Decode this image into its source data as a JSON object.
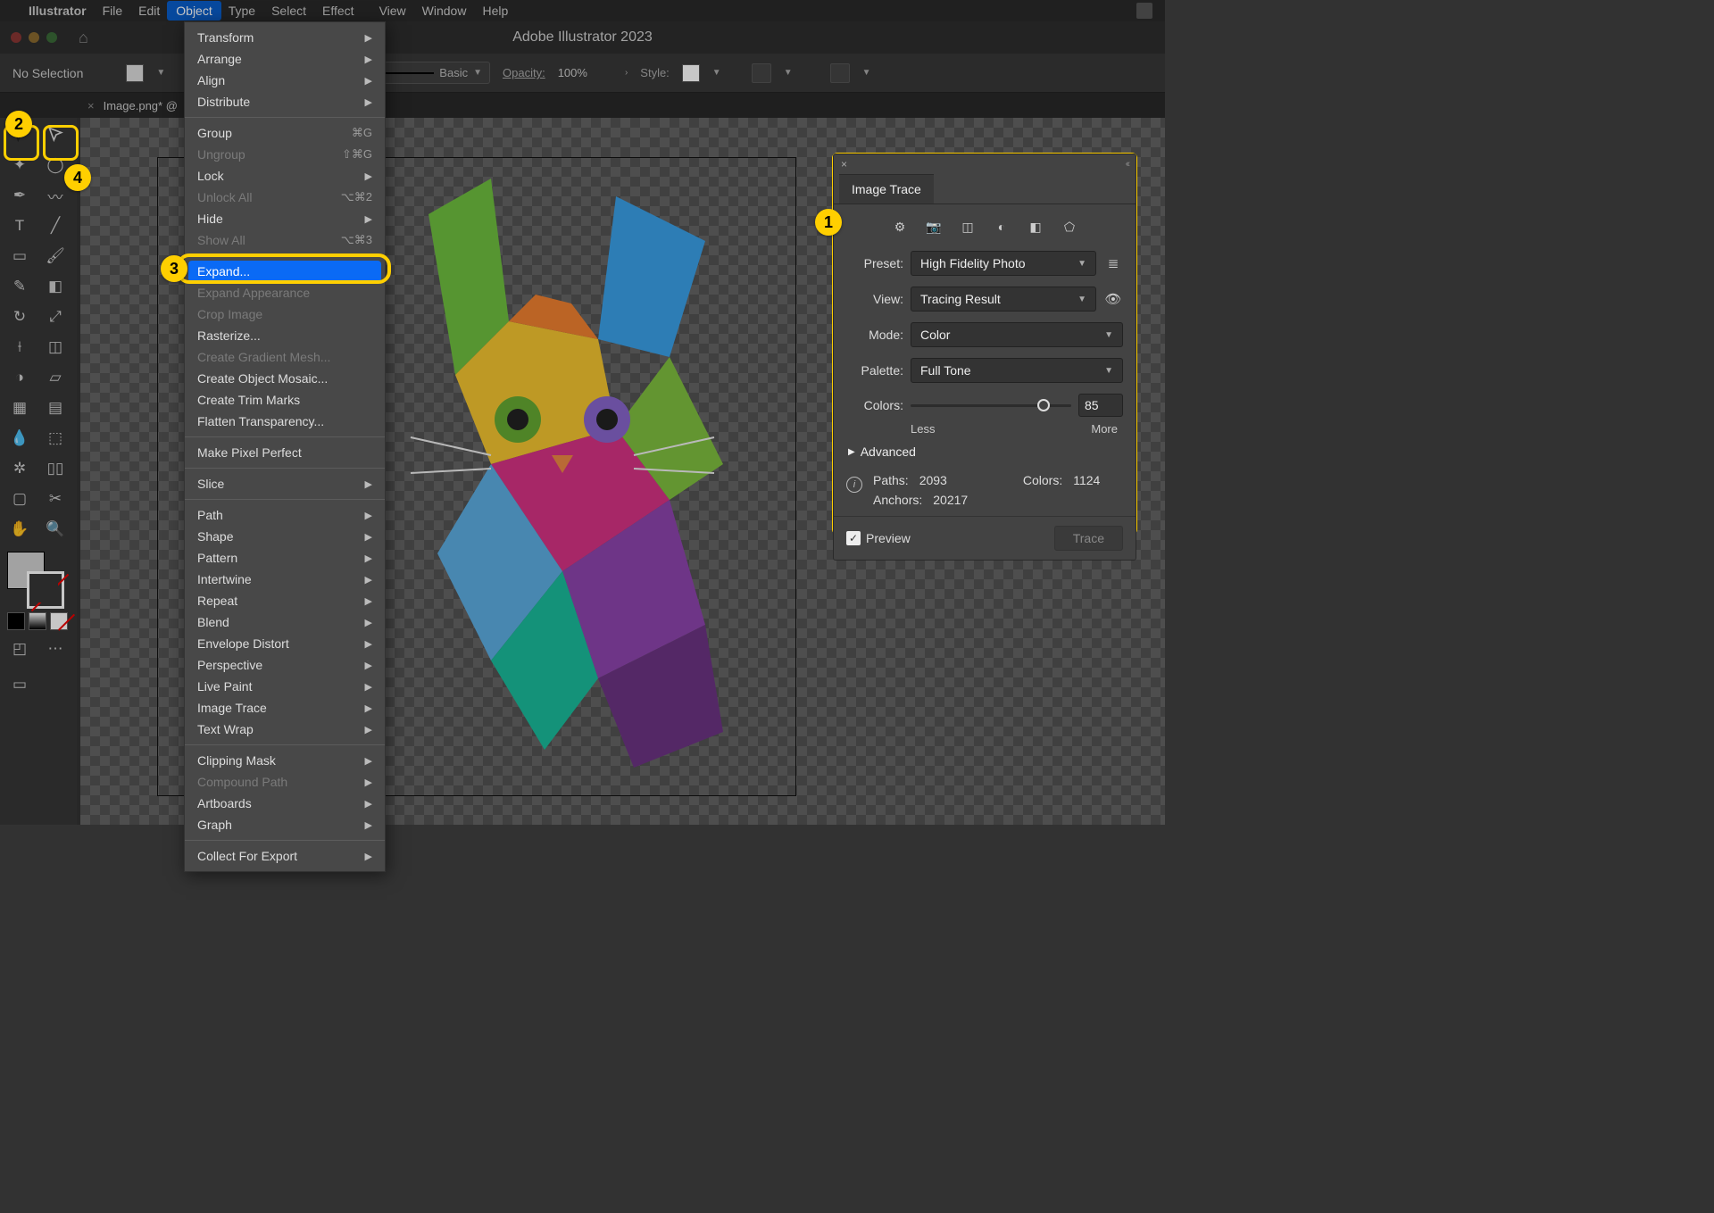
{
  "menubar": {
    "appname": "Illustrator",
    "items": [
      "File",
      "Edit",
      "Object",
      "Type",
      "Select",
      "Effect",
      "View",
      "Window",
      "Help"
    ],
    "active": "Object"
  },
  "window": {
    "title": "Adobe Illustrator 2023"
  },
  "optbar": {
    "selection": "No Selection",
    "stroke_style": "Basic",
    "opacity_label": "Opacity:",
    "opacity_value": "100%",
    "style_label": "Style:"
  },
  "doctab": {
    "name": "Image.png* @"
  },
  "dropdown": {
    "groups": [
      [
        {
          "label": "Transform",
          "arrow": true
        },
        {
          "label": "Arrange",
          "arrow": true
        },
        {
          "label": "Align",
          "arrow": true
        },
        {
          "label": "Distribute",
          "arrow": true
        }
      ],
      [
        {
          "label": "Group",
          "shortcut": "⌘G"
        },
        {
          "label": "Ungroup",
          "shortcut": "⇧⌘G",
          "disabled": true
        },
        {
          "label": "Lock",
          "arrow": true
        },
        {
          "label": "Unlock All",
          "shortcut": "⌥⌘2",
          "disabled": true
        },
        {
          "label": "Hide",
          "arrow": true
        },
        {
          "label": "Show All",
          "shortcut": "⌥⌘3",
          "disabled": true
        }
      ],
      [
        {
          "label": "Expand...",
          "highlight": true
        },
        {
          "label": "Expand Appearance",
          "disabled": true
        },
        {
          "label": "Crop Image",
          "disabled": true
        },
        {
          "label": "Rasterize..."
        },
        {
          "label": "Create Gradient Mesh...",
          "disabled": true
        },
        {
          "label": "Create Object Mosaic..."
        },
        {
          "label": "Create Trim Marks"
        },
        {
          "label": "Flatten Transparency..."
        }
      ],
      [
        {
          "label": "Make Pixel Perfect"
        }
      ],
      [
        {
          "label": "Slice",
          "arrow": true
        }
      ],
      [
        {
          "label": "Path",
          "arrow": true
        },
        {
          "label": "Shape",
          "arrow": true
        },
        {
          "label": "Pattern",
          "arrow": true
        },
        {
          "label": "Intertwine",
          "arrow": true
        },
        {
          "label": "Repeat",
          "arrow": true
        },
        {
          "label": "Blend",
          "arrow": true
        },
        {
          "label": "Envelope Distort",
          "arrow": true
        },
        {
          "label": "Perspective",
          "arrow": true
        },
        {
          "label": "Live Paint",
          "arrow": true
        },
        {
          "label": "Image Trace",
          "arrow": true
        },
        {
          "label": "Text Wrap",
          "arrow": true
        }
      ],
      [
        {
          "label": "Clipping Mask",
          "arrow": true
        },
        {
          "label": "Compound Path",
          "arrow": true,
          "disabled": true
        },
        {
          "label": "Artboards",
          "arrow": true
        },
        {
          "label": "Graph",
          "arrow": true
        }
      ],
      [
        {
          "label": "Collect For Export",
          "arrow": true
        }
      ]
    ]
  },
  "panel": {
    "title": "Image Trace",
    "preset_label": "Preset:",
    "preset_value": "High Fidelity Photo",
    "view_label": "View:",
    "view_value": "Tracing Result",
    "mode_label": "Mode:",
    "mode_value": "Color",
    "palette_label": "Palette:",
    "palette_value": "Full Tone",
    "colors_label": "Colors:",
    "colors_value": "85",
    "less": "Less",
    "more": "More",
    "advanced": "Advanced",
    "stats": {
      "paths_label": "Paths:",
      "paths": "2093",
      "colors_label": "Colors:",
      "colors": "1124",
      "anchors_label": "Anchors:",
      "anchors": "20217"
    },
    "preview": "Preview",
    "trace": "Trace"
  },
  "annotations": {
    "1": "1",
    "2": "2",
    "3": "3",
    "4": "4"
  }
}
